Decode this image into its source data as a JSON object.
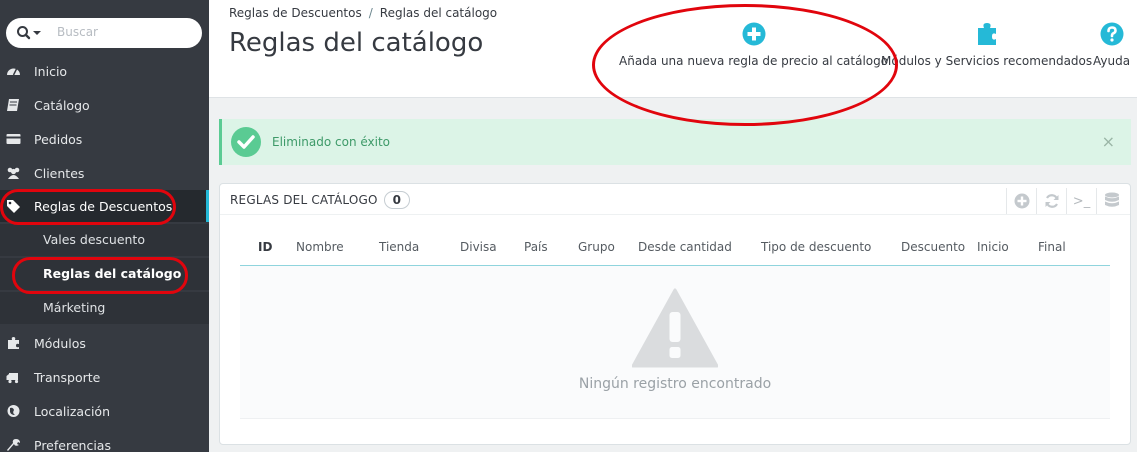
{
  "sidebar": {
    "search_placeholder": "Buscar",
    "items": [
      {
        "label": "Inicio",
        "icon": "dashboard-icon"
      },
      {
        "label": "Catálogo",
        "icon": "book-icon"
      },
      {
        "label": "Pedidos",
        "icon": "credit-card-icon"
      },
      {
        "label": "Clientes",
        "icon": "users-icon"
      },
      {
        "label": "Reglas de Descuentos",
        "icon": "tag-icon"
      },
      {
        "label": "Módulos",
        "icon": "puzzle-icon"
      },
      {
        "label": "Transporte",
        "icon": "truck-icon"
      },
      {
        "label": "Localización",
        "icon": "globe-icon"
      },
      {
        "label": "Preferencias",
        "icon": "wrench-icon"
      }
    ],
    "subitems": [
      {
        "label": "Vales descuento"
      },
      {
        "label": "Reglas del catálogo"
      },
      {
        "label": "Márketing"
      }
    ]
  },
  "header": {
    "breadcrumb": [
      "Reglas de Descuentos",
      "Reglas del catálogo"
    ],
    "breadcrumb_sep": "/",
    "title": "Reglas del catálogo",
    "toolbar": {
      "add_label": "Añada una nueva regla de precio al catálogo",
      "modules_label": "Módulos y Servicios recomendados",
      "help_label": "Ayuda"
    }
  },
  "alert": {
    "message": "Eliminado con éxito",
    "close": "×"
  },
  "panel": {
    "title": "REGLAS DEL CATÁLOGO",
    "count": "0",
    "tools": {
      "terminal": ">_"
    },
    "columns": [
      "ID",
      "Nombre",
      "Tienda",
      "Divisa",
      "País",
      "Grupo",
      "Desde cantidad",
      "Tipo de descuento",
      "Descuento",
      "Inicio",
      "Final"
    ],
    "empty_message": "Ningún registro encontrado"
  },
  "colors": {
    "sidebar": "#363a41",
    "accent": "#25b9d7",
    "success": "#5acb93",
    "annotation": "#e1050d"
  }
}
